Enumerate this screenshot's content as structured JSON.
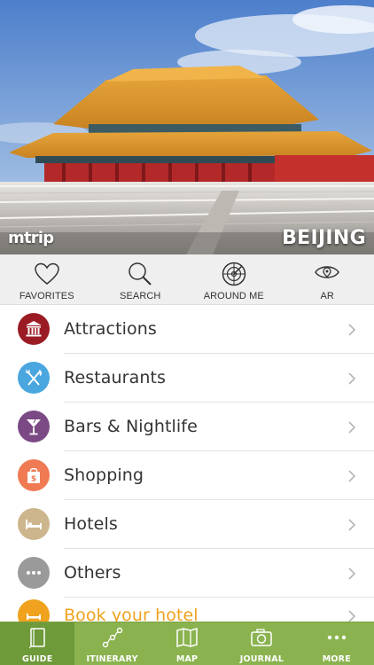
{
  "hero": {
    "brand": "mtrip",
    "city": "BEIJING"
  },
  "quick_actions": [
    {
      "label": "FAVORITES",
      "icon": "heart-icon"
    },
    {
      "label": "SEARCH",
      "icon": "search-icon"
    },
    {
      "label": "AROUND ME",
      "icon": "radar-icon"
    },
    {
      "label": "AR",
      "icon": "eye-location-icon"
    }
  ],
  "categories": [
    {
      "label": "Attractions",
      "icon": "landmark-icon",
      "color": "#9b1b24"
    },
    {
      "label": "Restaurants",
      "icon": "fork-knife-icon",
      "color": "#4aa6df"
    },
    {
      "label": "Bars & Nightlife",
      "icon": "cocktail-icon",
      "color": "#7b4a84"
    },
    {
      "label": "Shopping",
      "icon": "shopping-bag-icon",
      "color": "#ef7a53"
    },
    {
      "label": "Hotels",
      "icon": "bed-icon",
      "color": "#cdb58d"
    },
    {
      "label": "Others",
      "icon": "more-dots-icon",
      "color": "#9a9a9a"
    },
    {
      "label": "Book your hotel",
      "icon": "hotel-booking-icon",
      "color": "#f0a21e"
    }
  ],
  "tabs": [
    {
      "label": "GUIDE",
      "icon": "guide-book-icon",
      "active": true
    },
    {
      "label": "ITINERARY",
      "icon": "route-icon",
      "active": false
    },
    {
      "label": "MAP",
      "icon": "map-icon",
      "active": false
    },
    {
      "label": "JOURNAL",
      "icon": "camera-icon",
      "active": false
    },
    {
      "label": "MORE",
      "icon": "more-dots-icon",
      "active": false
    }
  ],
  "colors": {
    "tabbar": "#8ab34f",
    "tab_active": "#6e9a3a",
    "book_text": "#f0a21e"
  }
}
